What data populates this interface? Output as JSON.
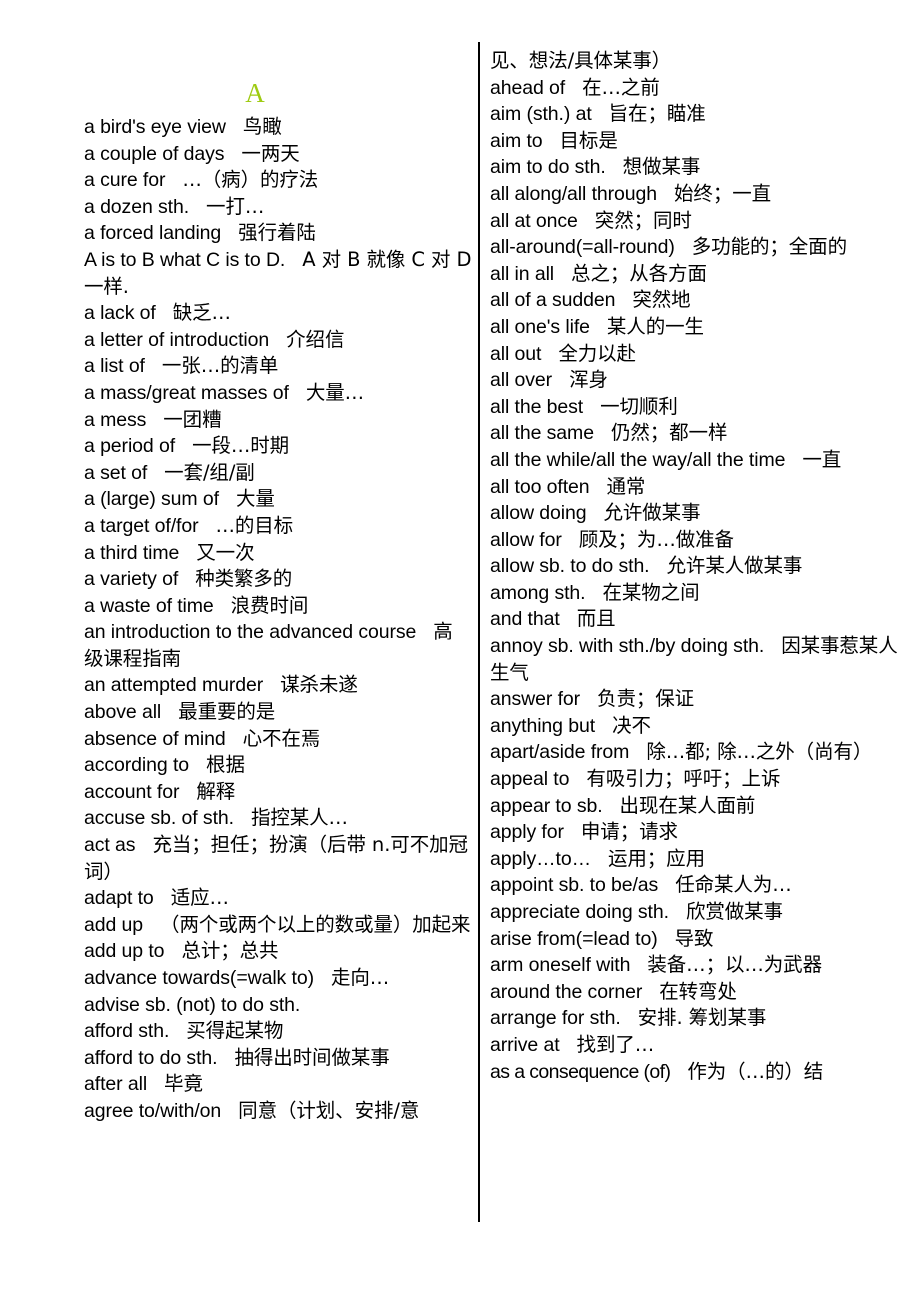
{
  "page": {
    "section_letter": "A",
    "section_letter_color": "#9ecb12",
    "background_color": "#ffffff",
    "text_color": "#000000",
    "layout": "two-column glossary with vertical divider"
  },
  "left_column": {
    "entries": [
      {
        "en": "a bird's eye view",
        "zh": "鸟瞰"
      },
      {
        "en": "a couple of days",
        "zh": "一两天"
      },
      {
        "en": "a cure for",
        "zh": "…（病）的疗法"
      },
      {
        "en": "a dozen sth.",
        "zh": "一打…"
      },
      {
        "en": "a forced landing",
        "zh": "强行着陆"
      },
      {
        "en": "A is to B what C is to D.",
        "zh": "A 对 B 就像 C 对 D 一样."
      },
      {
        "en": "a lack of",
        "zh": "缺乏…"
      },
      {
        "en": "a letter of introduction",
        "zh": "介绍信"
      },
      {
        "en": "a list of",
        "zh": "一张…的清单"
      },
      {
        "en": "a mass/great masses of",
        "zh": "大量…"
      },
      {
        "en": "a mess",
        "zh": "一团糟"
      },
      {
        "en": "a period of",
        "zh": "一段…时期"
      },
      {
        "en": "a set of",
        "zh": "一套/组/副"
      },
      {
        "en": "a (large) sum of",
        "zh": "大量"
      },
      {
        "en": "a target of/for",
        "zh": "…的目标"
      },
      {
        "en": "a third time",
        "zh": "又一次"
      },
      {
        "en": "a variety of",
        "zh": "种类繁多的"
      },
      {
        "en": "a waste of time",
        "zh": "浪费时间"
      },
      {
        "en": "an introduction to the advanced course",
        "zh": "高级课程指南"
      },
      {
        "en": "an attempted murder",
        "zh": "谋杀未遂"
      },
      {
        "en": "above all",
        "zh": "最重要的是"
      },
      {
        "en": "absence of mind",
        "zh": "心不在焉"
      },
      {
        "en": "according to",
        "zh": "根据"
      },
      {
        "en": "account for",
        "zh": "解释"
      },
      {
        "en": "accuse sb. of sth.",
        "zh": "指控某人…"
      },
      {
        "en": "act as",
        "zh": "充当；担任；扮演（后带 n.可不加冠词）"
      },
      {
        "en": "adapt to",
        "zh": "适应…"
      },
      {
        "en": "add up",
        "zh": "（两个或两个以上的数或量）加起来"
      },
      {
        "en": "add up to",
        "zh": "总计；总共"
      },
      {
        "en": "advance towards(=walk to)",
        "zh": "走向…"
      },
      {
        "en": "advise sb. (not) to do sth.",
        "zh": ""
      },
      {
        "en": "afford sth.",
        "zh": "买得起某物"
      },
      {
        "en": "afford to do sth.",
        "zh": "抽得出时间做某事"
      },
      {
        "en": "after all",
        "zh": "毕竟"
      },
      {
        "en": "agree to/with/on",
        "zh": "同意（计划、安排/意"
      }
    ]
  },
  "right_column": {
    "continuation_line": "见、想法/具体某事）",
    "entries": [
      {
        "en": "ahead of",
        "zh": "在…之前"
      },
      {
        "en": "aim (sth.) at",
        "zh": "旨在；瞄准"
      },
      {
        "en": "aim to",
        "zh": "目标是"
      },
      {
        "en": "aim to do sth.",
        "zh": "想做某事"
      },
      {
        "en": "all along/all through",
        "zh": "始终；一直"
      },
      {
        "en": "all at once",
        "zh": "突然；同时"
      },
      {
        "en": "all-around(=all-round)",
        "zh": "多功能的；全面的"
      },
      {
        "en": "all in all",
        "zh": "总之；从各方面"
      },
      {
        "en": "all of a sudden",
        "zh": "突然地"
      },
      {
        "en": "all one's life",
        "zh": "某人的一生"
      },
      {
        "en": "all out",
        "zh": "全力以赴"
      },
      {
        "en": "all over",
        "zh": "浑身"
      },
      {
        "en": "all the best",
        "zh": "一切顺利"
      },
      {
        "en": "all the same",
        "zh": "仍然；都一样"
      },
      {
        "en": "all the while/all the way/all the time",
        "zh": "一直"
      },
      {
        "en": "all too often",
        "zh": "通常"
      },
      {
        "en": "allow doing",
        "zh": "允许做某事"
      },
      {
        "en": "allow for",
        "zh": "顾及；为…做准备"
      },
      {
        "en": "allow sb. to do sth.",
        "zh": "允许某人做某事"
      },
      {
        "en": "among sth.",
        "zh": "在某物之间"
      },
      {
        "en": "and that",
        "zh": "而且"
      },
      {
        "en": "annoy sb. with sth./by doing sth.",
        "zh": "因某事惹某人生气"
      },
      {
        "en": "answer for",
        "zh": "负责；保证"
      },
      {
        "en": "anything but",
        "zh": "决不"
      },
      {
        "en": "apart/aside from",
        "zh": "除…都; 除…之外（尚有）"
      },
      {
        "en": "appeal to",
        "zh": "有吸引力；呼吁；上诉"
      },
      {
        "en": "appear to sb.",
        "zh": "出现在某人面前"
      },
      {
        "en": "apply for",
        "zh": "申请；请求"
      },
      {
        "en": "apply…to…",
        "zh": "运用；应用"
      },
      {
        "en": "appoint sb. to be/as",
        "zh": "任命某人为…"
      },
      {
        "en": "appreciate doing sth.",
        "zh": "欣赏做某事"
      },
      {
        "en": "arise from(=lead to)",
        "zh": "导致"
      },
      {
        "en": "arm oneself with",
        "zh": "装备…；以…为武器"
      },
      {
        "en": "around the corner",
        "zh": "在转弯处"
      },
      {
        "en": "arrange for sth.",
        "zh": "安排. 筹划某事"
      },
      {
        "en": "arrive at",
        "zh": "找到了…"
      },
      {
        "en": "as a consequence (of)",
        "zh": "作为（…的）结",
        "tight": true
      }
    ]
  }
}
